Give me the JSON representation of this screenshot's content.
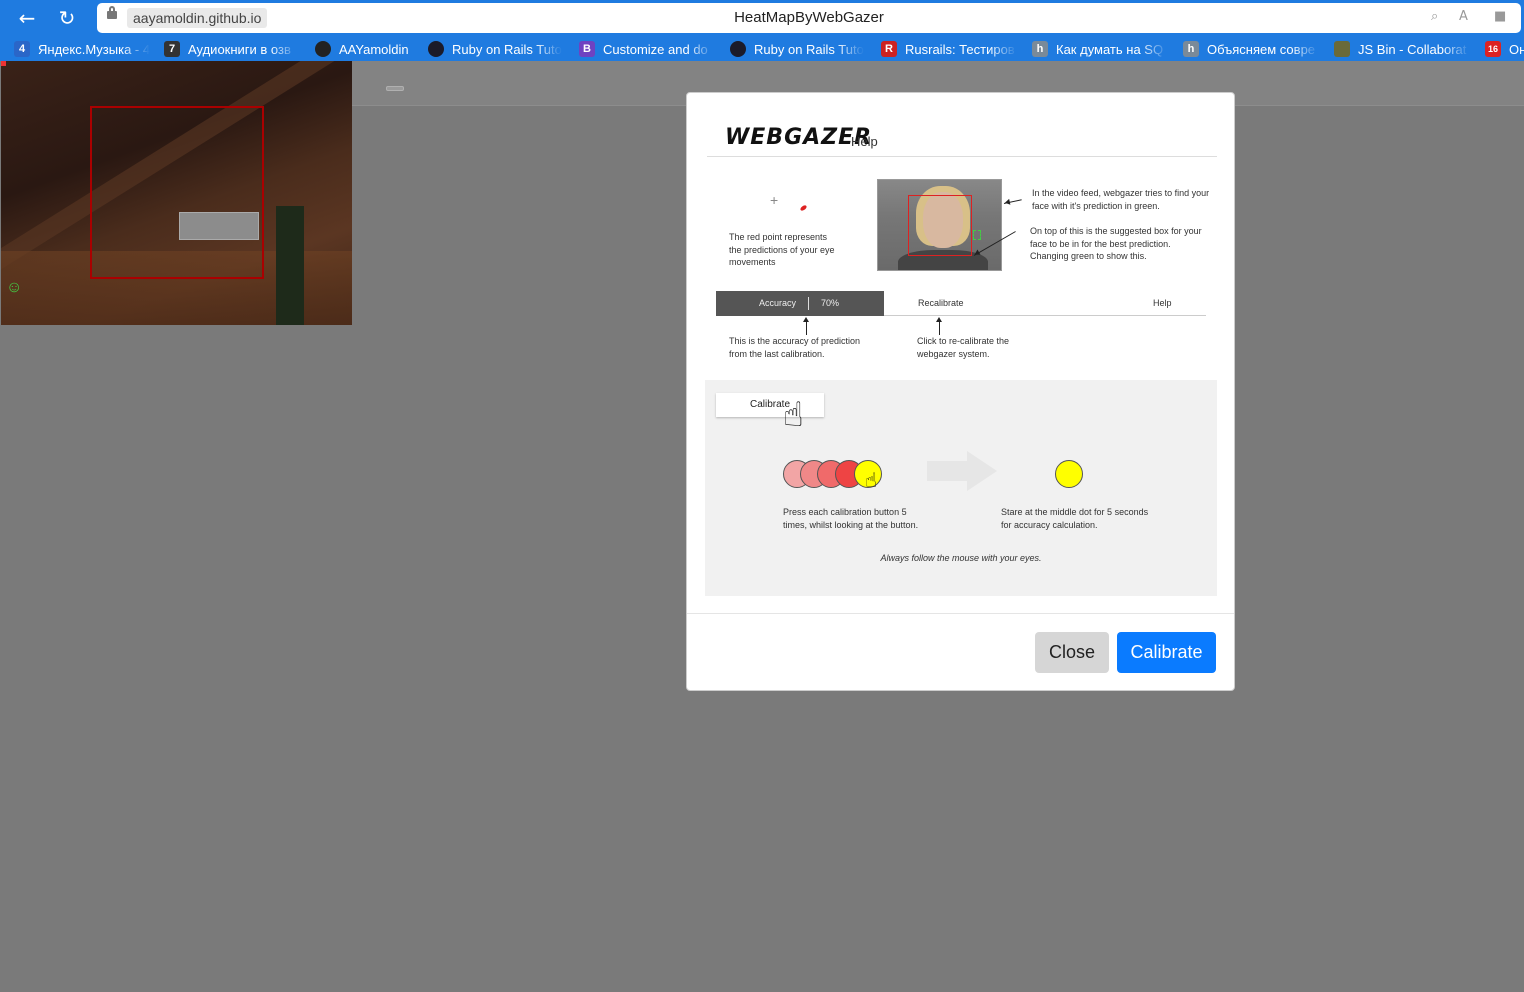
{
  "browser": {
    "back_icon": "arrow-left-icon",
    "reload_icon": "reload-icon",
    "domain": "aayamoldin.github.io",
    "tab_title": "HeatMapByWebGazer",
    "bookmarks": [
      {
        "label": "Яндекс.Музыка - 4",
        "icon": "4",
        "color": "#2a66c8"
      },
      {
        "label": "Аудиокниги в озв",
        "icon": "7",
        "color": "#333333"
      },
      {
        "label": "AAYamoldin",
        "icon": "gh",
        "color": "#222222"
      },
      {
        "label": "Ruby on Rails Tuto",
        "icon": "rt",
        "color": "#1b1b2a"
      },
      {
        "label": "Customize and do",
        "icon": "B",
        "color": "#6f42c1"
      },
      {
        "label": "Ruby on Rails Tuto",
        "icon": "rt",
        "color": "#1b1b2a"
      },
      {
        "label": "Rusrails: Тестиров",
        "icon": "R",
        "color": "#cc2222"
      },
      {
        "label": "Как думать на SQ",
        "icon": "h",
        "color": "#7a8a99"
      },
      {
        "label": "Объясняем совре",
        "icon": "h",
        "color": "#7a8a99"
      },
      {
        "label": "JS Bin - Collaborat",
        "icon": "js",
        "color": "#6a6a3a"
      },
      {
        "label": "Он",
        "icon": "16",
        "color": "#d22222"
      }
    ]
  },
  "help": {
    "logo": "WEBGAZER",
    "subtitle": "Help",
    "plus": "+",
    "red_point_text": "The red point represents the predictions of your eye movements",
    "video_text_1": "In the video feed, webgazer tries to find your face with it's prediction in green.",
    "video_text_2": "On top of this is the suggested box for your face to be in for the best prediction. Changing green to show this.",
    "accuracy_label": "Accuracy",
    "accuracy_value": "70%",
    "recalibrate_label": "Recalibrate",
    "help_label": "Help",
    "accuracy_text": "This is the accuracy of prediction from the last calibration.",
    "recalibrate_text": "Click to re-calibrate the webgazer system.",
    "calibrate_button": "Calibrate",
    "press_text": "Press each calibration button 5 times, whilst looking at the button.",
    "stare_text": "Stare at the middle dot for 5 seconds for accuracy calculation.",
    "follow_text": "Always follow the mouse with your eyes."
  },
  "modal": {
    "close_label": "Close",
    "calibrate_label": "Calibrate"
  },
  "colors": {
    "chrome": "#1f7be0",
    "primary_button": "#0a7bff",
    "secondary_button": "#d6d6d6",
    "overlay": "#7a7a7a",
    "calibration_dot": "#ffff00"
  }
}
